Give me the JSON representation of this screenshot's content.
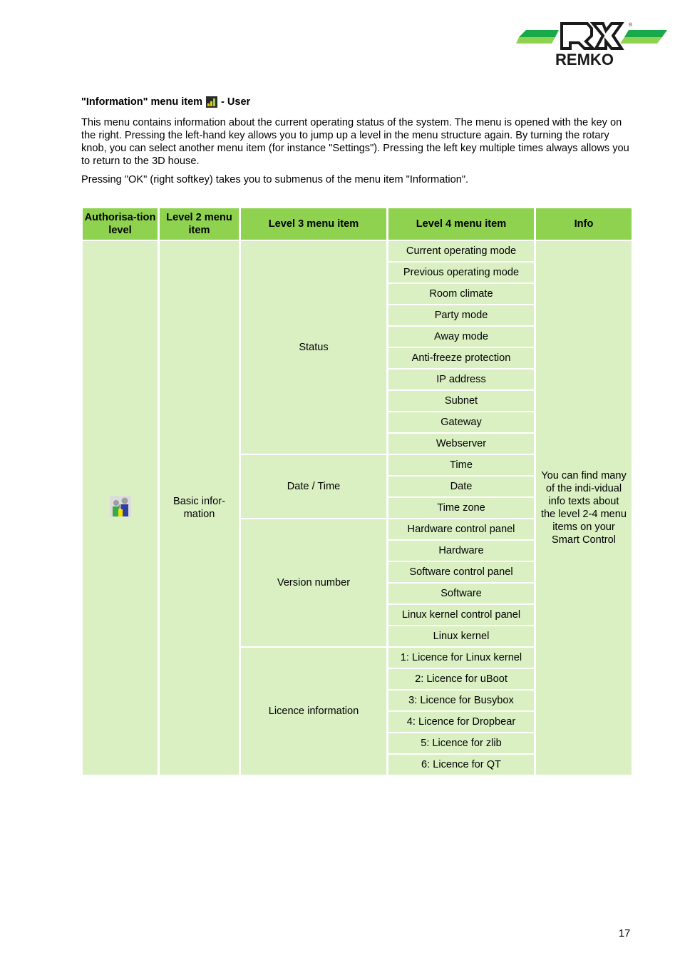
{
  "logo": {
    "brand": "REMKO",
    "registered_mark": "®",
    "colors": {
      "stripe_dark": "#17a94a",
      "stripe_light": "#8ed24f",
      "text": "#1a1a1a"
    }
  },
  "heading": {
    "prefix": "\"Information\" menu item",
    "icon": "information-bar-chart-icon",
    "suffix": "- User"
  },
  "paragraphs": [
    "This menu contains information about the current operating status of the system. The menu is opened with the key on the right. Pressing the left-hand key allows you to jump up a level in the menu structure again. By turning the rotary knob, you can select another menu item (for instance \"Settings\"). Pressing the left key multiple times always allows you to return to the 3D house.",
    "Pressing \"OK\" (right softkey) takes you to submenus of the menu item \"Information\"."
  ],
  "table": {
    "headers": [
      "Authorisa-tion level",
      "Level 2 menu item",
      "Level 3 menu item",
      "Level 4 menu item",
      "Info"
    ],
    "authorisation_icon": "user-family-icon",
    "level2": "Basic infor-mation",
    "info": "You can find many of the indi-vidual info texts about the level 2-4 menu items on your Smart Control",
    "groups": [
      {
        "level3": "Status",
        "items": [
          "Current operating mode",
          "Previous operating mode",
          "Room climate",
          "Party mode",
          "Away mode",
          "Anti-freeze protection",
          "IP address",
          "Subnet",
          "Gateway",
          "Webserver"
        ]
      },
      {
        "level3": "Date / Time",
        "items": [
          "Time",
          "Date",
          "Time zone"
        ]
      },
      {
        "level3": "Version number",
        "items": [
          "Hardware control panel",
          "Hardware",
          "Software control panel",
          "Software",
          "Linux kernel control panel",
          "Linux kernel"
        ]
      },
      {
        "level3": "Licence information",
        "items": [
          "1: Licence for Linux kernel",
          "2: Licence for uBoot",
          "3: Licence for Busybox",
          "4: Licence for Dropbear",
          "5: Licence for zlib",
          "6: Licence for QT"
        ]
      }
    ],
    "colors": {
      "header_bg": "#8ed24f",
      "body_bg": "#daf0c3"
    }
  },
  "page_number": "17"
}
